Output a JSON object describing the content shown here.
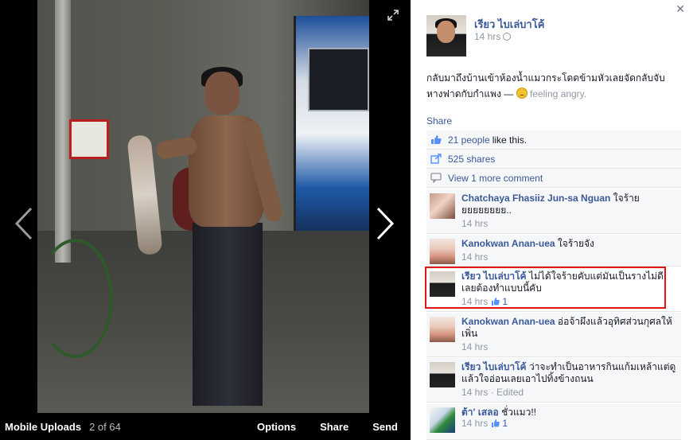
{
  "photo_bar": {
    "album": "Mobile Uploads",
    "position": "2 of 64",
    "actions": [
      "Options",
      "Share",
      "Send"
    ]
  },
  "post": {
    "author": "เรียว ไบเล่บาโค้",
    "time": "14 hrs",
    "text": "กลับมาถึงบ้านเข้าห้องน้ำแมวกระโดดข้ามหัวเลยจัดกลับจับหางฟาดกับกำแพง —",
    "feeling": "feeling angry."
  },
  "ufi": {
    "share": "Share",
    "likes_link": "21 people",
    "likes_text": "like this.",
    "shares": "525 shares",
    "more_comments": "View 1 more comment"
  },
  "comments": [
    {
      "name": "Chatchaya Fhasiiz Jun-sa Nguan",
      "text": "ใจร้ายยยยยยยยย..",
      "time": "14 hrs",
      "likes": ""
    },
    {
      "name": "Kanokwan Anan-uea",
      "text": "ใจร้ายจัง",
      "time": "14 hrs",
      "likes": ""
    },
    {
      "name": "เรียว ไบเล่บาโค้",
      "text": "ไม่ได้ใจร้ายคับแต่มันเป็นรางไม่ดีเลยต้องทำแบบนี้คับ",
      "time": "14 hrs",
      "likes": "1"
    },
    {
      "name": "Kanokwan Anan-uea",
      "text": "อ่อจ้าผึงแล้วอุทิศส่วนกุศลให้เพิ่น",
      "time": "14 hrs",
      "likes": ""
    },
    {
      "name": "เรียว ไบเล่บาโค้",
      "text": "ว่าจะทำเป็นอาหารกินแก้มเหล้าแต่ดูแล้วใจอ่อนเลยเอาไปทิ้งข้างถนน",
      "time": "14 hrs",
      "edited": "Edited",
      "likes": ""
    },
    {
      "name": "ต้า' เสลอ",
      "text": "ชั่วแมว!!",
      "time": "14 hrs",
      "likes": "1"
    }
  ],
  "colors": {
    "link": "#3b5998",
    "meta": "#9197a3",
    "highlight": "#e01616"
  }
}
